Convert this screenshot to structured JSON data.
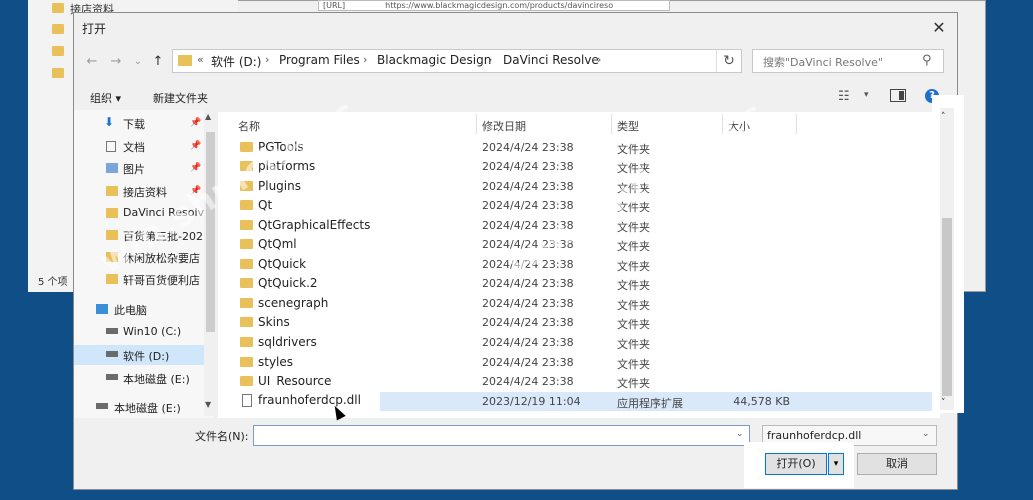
{
  "background_window": {
    "left_items": [
      "接店资料",
      "",
      "",
      "",
      "",
      ""
    ],
    "url_label": "[URL]",
    "url_value": "https://www.blackmagicdesign.com/products/davinciresо",
    "status_count": "5 个项"
  },
  "dialog": {
    "title": "打开",
    "close_glyph": "✕",
    "nav": {
      "back": "←",
      "forward": "→",
      "dropdown": "⌄",
      "up": "↑"
    },
    "breadcrumb_prefix": "«",
    "breadcrumb": [
      "软件 (D:)",
      "Program Files",
      "Blackmagic Design",
      "DaVinci Resolve"
    ],
    "breadcrumb_sep": "›",
    "refresh_glyph": "↻",
    "search_placeholder": "搜索\"DaVinci Resolve\"",
    "search_glyph": "⚲",
    "toolbar": {
      "organize": "组织 ▾",
      "new_folder": "新建文件夹",
      "view_glyph": "☷",
      "view_dd": "▾",
      "help_glyph": "?"
    }
  },
  "nav_pane": {
    "items": [
      {
        "label": "下载",
        "icon": "download-icon",
        "pinned": true
      },
      {
        "label": "文档",
        "icon": "documents-icon",
        "pinned": true
      },
      {
        "label": "图片",
        "icon": "pictures-icon",
        "pinned": true
      },
      {
        "label": "接店资料",
        "icon": "folder-icon",
        "pinned": true
      },
      {
        "label": "DaVinci Resolv",
        "icon": "folder-icon",
        "pinned": false
      },
      {
        "label": "百货第三批-202",
        "icon": "folder-icon",
        "pinned": false
      },
      {
        "label": "休闲放松杂要店",
        "icon": "folder-icon",
        "pinned": false
      },
      {
        "label": "轩哥百货便利店",
        "icon": "folder-icon",
        "pinned": false
      },
      {
        "label": "此电脑",
        "icon": "pc-icon",
        "pinned": false
      },
      {
        "label": "Win10 (C:)",
        "icon": "drive-icon",
        "pinned": false
      },
      {
        "label": "软件 (D:)",
        "icon": "drive-icon",
        "pinned": false
      },
      {
        "label": "本地磁盘 (E:)",
        "icon": "drive-icon",
        "pinned": false
      },
      {
        "label": "本地磁盘 (E:)",
        "icon": "drive-icon",
        "pinned": false
      }
    ],
    "pin_glyph": "📌",
    "scroll_up": "▲",
    "scroll_down": "▼"
  },
  "file_list": {
    "headers": {
      "name": "名称",
      "date": "修改日期",
      "type": "类型",
      "size": "大小"
    },
    "rows": [
      {
        "name": "PGTools",
        "date": "2024/4/24 23:38",
        "type": "文件夹",
        "size": ""
      },
      {
        "name": "platforms",
        "date": "2024/4/24 23:38",
        "type": "文件夹",
        "size": ""
      },
      {
        "name": "Plugins",
        "date": "2024/4/24 23:38",
        "type": "文件夹",
        "size": ""
      },
      {
        "name": "Qt",
        "date": "2024/4/24 23:38",
        "type": "文件夹",
        "size": ""
      },
      {
        "name": "QtGraphicalEffects",
        "date": "2024/4/24 23:38",
        "type": "文件夹",
        "size": ""
      },
      {
        "name": "QtQml",
        "date": "2024/4/24 23:38",
        "type": "文件夹",
        "size": ""
      },
      {
        "name": "QtQuick",
        "date": "2024/4/24 23:38",
        "type": "文件夹",
        "size": ""
      },
      {
        "name": "QtQuick.2",
        "date": "2024/4/24 23:38",
        "type": "文件夹",
        "size": ""
      },
      {
        "name": "scenegraph",
        "date": "2024/4/24 23:38",
        "type": "文件夹",
        "size": ""
      },
      {
        "name": "Skins",
        "date": "2024/4/24 23:38",
        "type": "文件夹",
        "size": ""
      },
      {
        "name": "sqldrivers",
        "date": "2024/4/24 23:38",
        "type": "文件夹",
        "size": ""
      },
      {
        "name": "styles",
        "date": "2024/4/24 23:38",
        "type": "文件夹",
        "size": ""
      },
      {
        "name": "UI_Resource",
        "date": "2024/4/24 23:38",
        "type": "文件夹",
        "size": ""
      },
      {
        "name": "fraunhoferdcp.dll",
        "date": "2023/12/19 11:04",
        "type": "应用程序扩展",
        "size": "44,578 KB"
      }
    ],
    "scroll_up": "˄",
    "scroll_down": "˅"
  },
  "bottom": {
    "filename_label": "文件名(N):",
    "filename_value": "",
    "dropdown_glyph": "⌄",
    "filetype_value": "fraunhoferdcp.dll",
    "open_label": "打开(O)",
    "open_split_glyph": "▾",
    "cancel_label": "取消"
  },
  "watermark": [
    "win.shuiche.cc",
    "win.shuiche.cc"
  ],
  "colors": {
    "desktop": "#0f4e86",
    "accent": "#0078d7",
    "folder": "#e8c15a",
    "selection": "#cfe6fb"
  }
}
